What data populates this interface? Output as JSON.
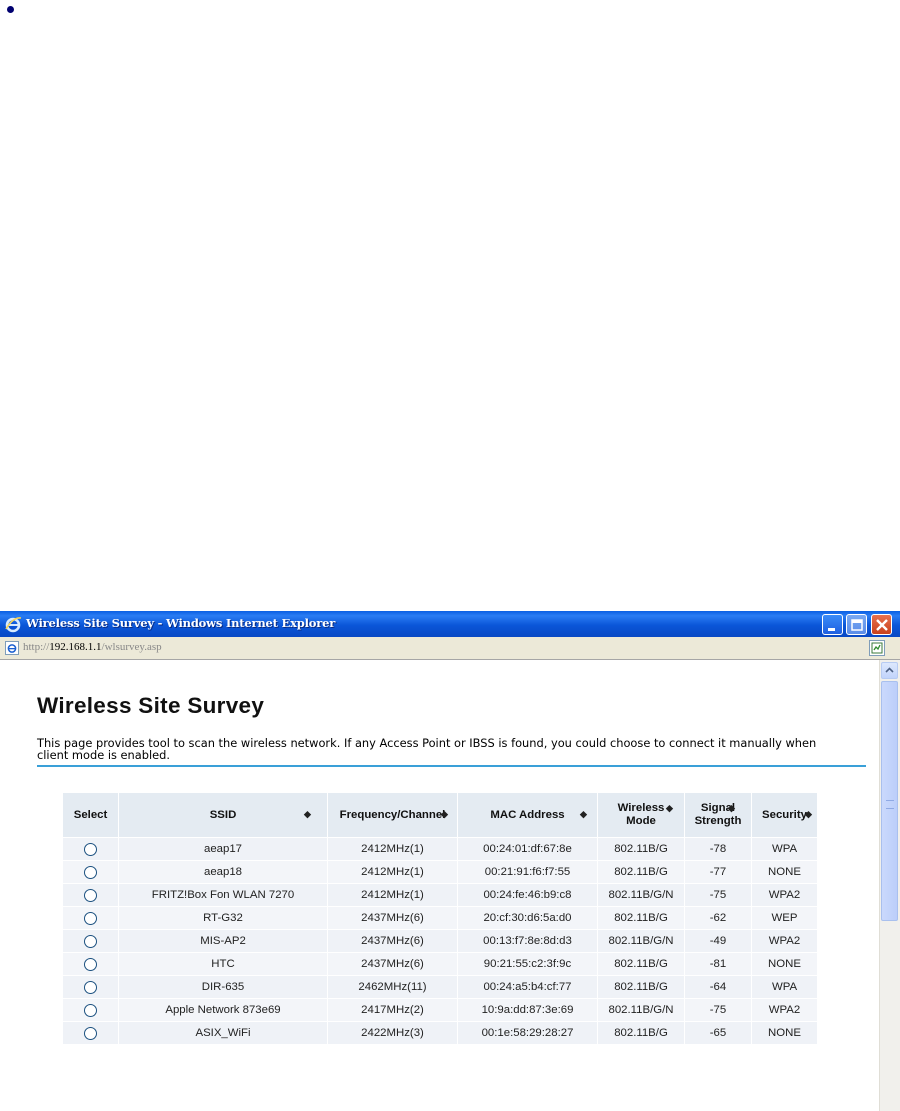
{
  "window": {
    "title": "Wireless Site Survey - Windows Internet Explorer",
    "url_prefix": "http://",
    "url_host": "192.168.1.1",
    "url_path": "/wlsurvey.asp"
  },
  "page": {
    "title": "Wireless Site Survey",
    "intro": "This page provides tool to scan the wireless network. If any Access Point or IBSS is found, you could choose to connect it manually when client mode is enabled."
  },
  "table": {
    "headers": {
      "select": "Select",
      "ssid": "SSID",
      "frequency": "Frequency/Channel",
      "mac": "MAC Address",
      "mode_line1": "Wireless",
      "mode_line2": "Mode",
      "signal_line1": "Signal",
      "signal_line2": "Strength",
      "security": "Security"
    },
    "rows": [
      {
        "ssid": "aeap17",
        "frequency": "2412MHz(1)",
        "mac": "00:24:01:df:67:8e",
        "mode": "802.11B/G",
        "signal": "-78",
        "security": "WPA"
      },
      {
        "ssid": "aeap18",
        "frequency": "2412MHz(1)",
        "mac": "00:21:91:f6:f7:55",
        "mode": "802.11B/G",
        "signal": "-77",
        "security": "NONE"
      },
      {
        "ssid": "FRITZ!Box Fon WLAN 7270",
        "frequency": "2412MHz(1)",
        "mac": "00:24:fe:46:b9:c8",
        "mode": "802.11B/G/N",
        "signal": "-75",
        "security": "WPA2"
      },
      {
        "ssid": "RT-G32",
        "frequency": "2437MHz(6)",
        "mac": "20:cf:30:d6:5a:d0",
        "mode": "802.11B/G",
        "signal": "-62",
        "security": "WEP"
      },
      {
        "ssid": "MIS-AP2",
        "frequency": "2437MHz(6)",
        "mac": "00:13:f7:8e:8d:d3",
        "mode": "802.11B/G/N",
        "signal": "-49",
        "security": "WPA2"
      },
      {
        "ssid": "HTC",
        "frequency": "2437MHz(6)",
        "mac": "90:21:55:c2:3f:9c",
        "mode": "802.11B/G",
        "signal": "-81",
        "security": "NONE"
      },
      {
        "ssid": "DIR-635",
        "frequency": "2462MHz(11)",
        "mac": "00:24:a5:b4:cf:77",
        "mode": "802.11B/G",
        "signal": "-64",
        "security": "WPA"
      },
      {
        "ssid": "Apple Network 873e69",
        "frequency": "2417MHz(2)",
        "mac": "10:9a:dd:87:3e:69",
        "mode": "802.11B/G/N",
        "signal": "-75",
        "security": "WPA2"
      },
      {
        "ssid": "ASIX_WiFi",
        "frequency": "2422MHz(3)",
        "mac": "00:1e:58:29:28:27",
        "mode": "802.11B/G",
        "signal": "-65",
        "security": "NONE"
      }
    ]
  },
  "icons": {
    "bullet": "bullet-dot-icon",
    "ie_logo": "ie-logo-icon",
    "page": "ie-page-icon",
    "compat": "compatibility-view-icon",
    "sort": "sort-arrows-icon",
    "minimize": "minimize-icon",
    "maximize": "maximize-icon",
    "close": "close-icon"
  },
  "colors": {
    "titlebar": "#0a5fe3",
    "rule": "#3aa0d8",
    "header_bg": "#e4ebf2",
    "row_bg": "#eff2f7"
  }
}
